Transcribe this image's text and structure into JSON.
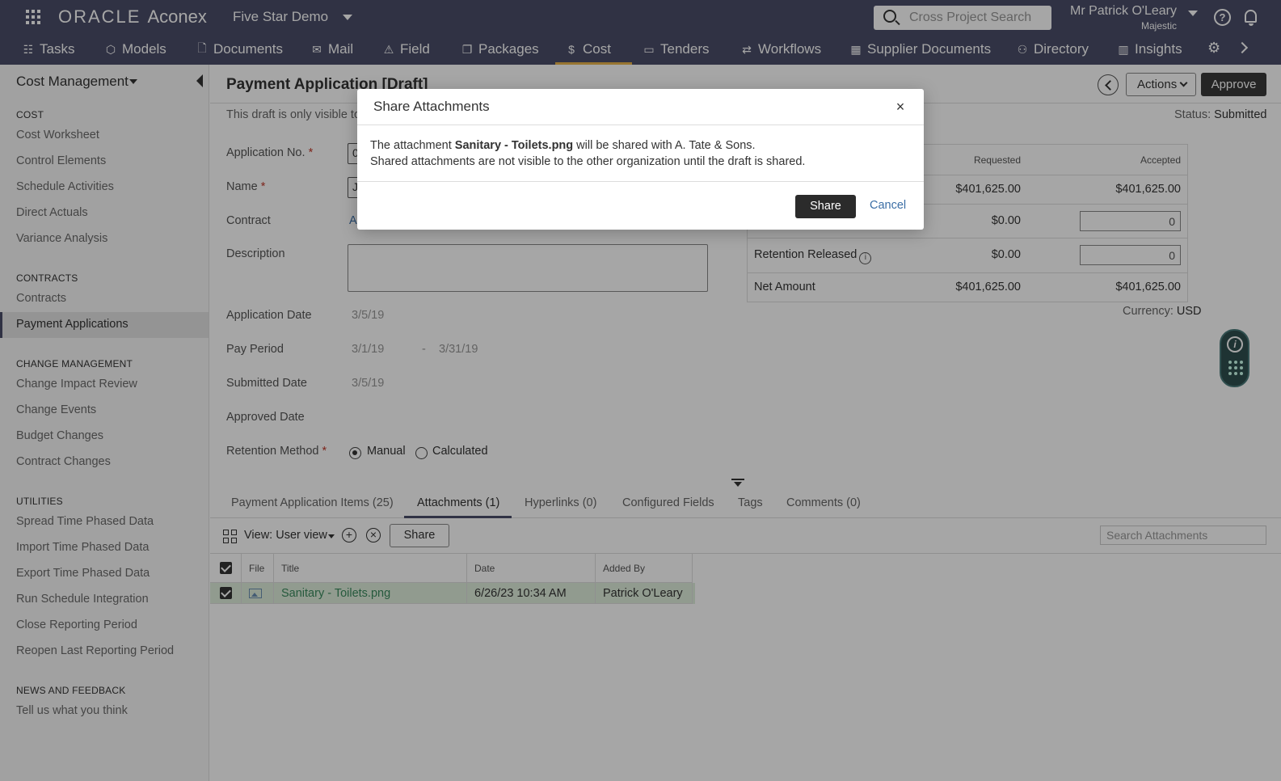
{
  "app": {
    "logo_brand": "ORACLE",
    "logo_product": "Aconex",
    "project": "Five Star Demo",
    "search_placeholder": "Cross Project Search",
    "user_name": "Mr Patrick O'Leary",
    "user_org": "Majestic"
  },
  "icons": {
    "apps": "grid-icon",
    "search": "magnifier-icon",
    "help": "question-icon",
    "notifications": "bell-icon",
    "settings": "gear-icon"
  },
  "nav": {
    "active": "Cost",
    "active_color": "#e9b44c",
    "items": [
      {
        "label": "Tasks",
        "icon": "☷"
      },
      {
        "label": "Models",
        "icon": "⬡"
      },
      {
        "label": "Documents",
        "icon": "🗋"
      },
      {
        "label": "Mail",
        "icon": "✉"
      },
      {
        "label": "Field",
        "icon": "⚠"
      },
      {
        "label": "Packages",
        "icon": "❐"
      },
      {
        "label": "Cost",
        "icon": "$"
      },
      {
        "label": "Tenders",
        "icon": "▭"
      },
      {
        "label": "Workflows",
        "icon": "⇄"
      },
      {
        "label": "Supplier Documents",
        "icon": "▦"
      },
      {
        "label": "Directory",
        "icon": "⚇"
      },
      {
        "label": "Insights",
        "icon": "▥"
      }
    ]
  },
  "sidebar": {
    "title": "Cost Management",
    "sections": [
      {
        "heading": "COST",
        "items": [
          "Cost Worksheet",
          "Control Elements",
          "Schedule Activities",
          "Direct Actuals",
          "Variance Analysis"
        ]
      },
      {
        "heading": "CONTRACTS",
        "items": [
          "Contracts",
          "Payment Applications"
        ]
      },
      {
        "heading": "CHANGE MANAGEMENT",
        "items": [
          "Change Impact Review",
          "Change Events",
          "Budget Changes",
          "Contract Changes"
        ]
      },
      {
        "heading": "UTILITIES",
        "items": [
          "Spread Time Phased Data",
          "Import Time Phased Data",
          "Export Time Phased Data",
          "Run Schedule Integration",
          "Close Reporting Period",
          "Reopen Last Reporting Period"
        ]
      },
      {
        "heading": "NEWS AND FEEDBACK",
        "items": [
          "Tell us what you think"
        ]
      }
    ],
    "active_item": "Payment Applications"
  },
  "page": {
    "title": "Payment Application [Draft]",
    "draft_note": "This draft is only visible to",
    "actions_label": "Actions",
    "approve_label": "Approve",
    "status_label": "Status",
    "status_value": "Submitted"
  },
  "form": {
    "application_no_label": "Application No.",
    "application_no_value": "0",
    "name_label": "Name",
    "name_value": "J",
    "contract_label": "Contract",
    "contract_value": "A",
    "description_label": "Description",
    "application_date_label": "Application Date",
    "application_date_value": "3/5/19",
    "pay_period_label": "Pay Period",
    "pay_period_from": "3/1/19",
    "pay_period_sep": "-",
    "pay_period_to": "3/31/19",
    "submitted_date_label": "Submitted Date",
    "submitted_date_value": "3/5/19",
    "approved_date_label": "Approved Date",
    "retention_method_label": "Retention Method",
    "retention_manual": "Manual",
    "retention_calculated": "Calculated",
    "retention_selected": "Manual"
  },
  "summary": {
    "col_requested": "Requested",
    "col_accepted": "Accepted",
    "rows": [
      {
        "label": "",
        "requested": "$401,625.00",
        "accepted": "$401,625.00"
      },
      {
        "label": "",
        "requested": "$0.00",
        "accepted_input": "0"
      },
      {
        "label": "Retention Released",
        "requested": "$0.00",
        "accepted_input": "0"
      },
      {
        "label": "Net Amount",
        "requested": "$401,625.00",
        "accepted": "$401,625.00"
      }
    ],
    "currency_label": "Currency",
    "currency_value": "USD"
  },
  "tabs": [
    {
      "label": "Payment Application Items (25)"
    },
    {
      "label": "Attachments (1)"
    },
    {
      "label": "Hyperlinks (0)"
    },
    {
      "label": "Configured Fields"
    },
    {
      "label": "Tags"
    },
    {
      "label": "Comments (0)"
    }
  ],
  "active_tab": "Attachments (1)",
  "attachments": {
    "view_label": "View: User view",
    "add_symbol": "+",
    "remove_symbol": "×",
    "share_label": "Share",
    "search_placeholder": "Search Attachments",
    "columns": [
      "File",
      "Title",
      "Date",
      "Added By"
    ],
    "rows": [
      {
        "title": "Sanitary - Toilets.png",
        "date": "6/26/23 10:34 AM",
        "added_by": "Patrick O'Leary",
        "selected": true
      }
    ]
  },
  "modal": {
    "title": "Share Attachments",
    "close_symbol": "×",
    "line1_prefix": "The attachment ",
    "line1_file": "Sanitary - Toilets.png",
    "line1_suffix": " will be shared with A. Tate & Sons.",
    "line2": "Shared attachments are not visible to the other organization until the draft is shared.",
    "share_label": "Share",
    "cancel_label": "Cancel"
  }
}
